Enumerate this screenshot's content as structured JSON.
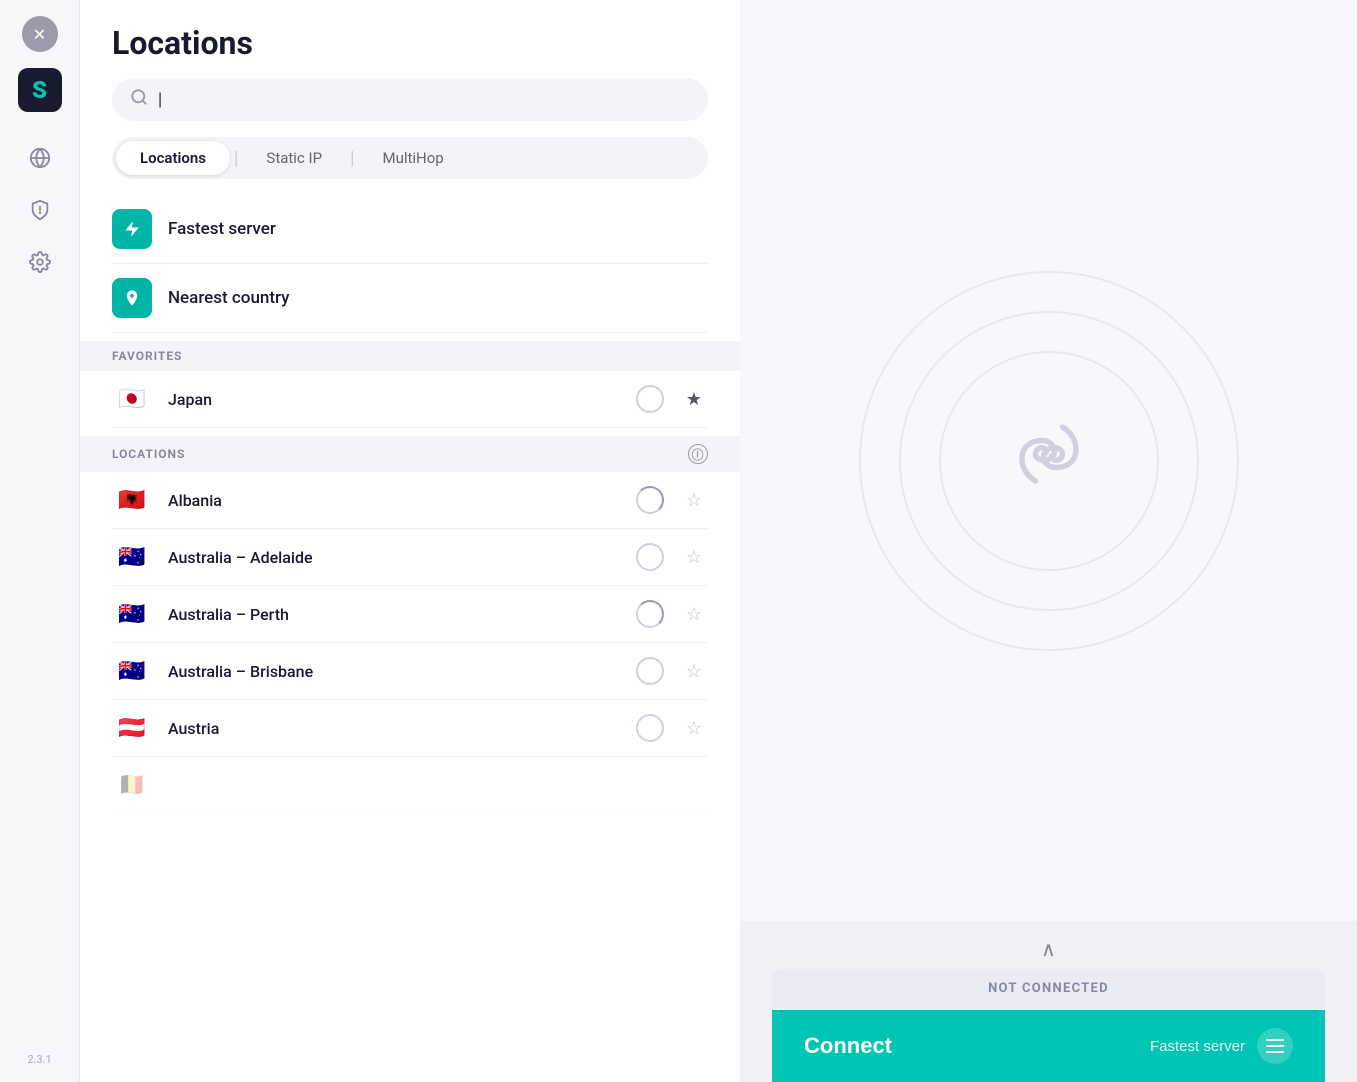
{
  "app": {
    "version": "2.3.1",
    "title": "Locations"
  },
  "sidebar": {
    "close_icon": "×",
    "logo_icon": "S",
    "items": [
      {
        "id": "locations",
        "icon": "🌐",
        "label": "Locations"
      },
      {
        "id": "shield",
        "icon": "🛡",
        "label": "Shield"
      },
      {
        "id": "settings",
        "icon": "⚙",
        "label": "Settings"
      }
    ]
  },
  "tabs": [
    {
      "id": "locations",
      "label": "Locations",
      "active": true
    },
    {
      "id": "static-ip",
      "label": "Static IP",
      "active": false
    },
    {
      "id": "multihop",
      "label": "MultiHop",
      "active": false
    }
  ],
  "search": {
    "placeholder": "",
    "value": ""
  },
  "special_items": [
    {
      "id": "fastest",
      "label": "Fastest server",
      "icon": "⚡"
    },
    {
      "id": "nearest",
      "label": "Nearest country",
      "icon": "📍"
    }
  ],
  "sections": {
    "favorites": {
      "header": "FAVORITES",
      "items": [
        {
          "id": "japan",
          "name": "Japan",
          "flag": "🇯🇵",
          "starred": true,
          "connected": false
        }
      ]
    },
    "locations": {
      "header": "LOCATIONS",
      "items": [
        {
          "id": "albania",
          "name": "Albania",
          "flag": "🇦🇱",
          "starred": false,
          "connected": false,
          "half": true
        },
        {
          "id": "australia-adelaide",
          "name": "Australia – Adelaide",
          "flag": "🇦🇺",
          "starred": false,
          "connected": false,
          "half": false
        },
        {
          "id": "australia-perth",
          "name": "Australia – Perth",
          "flag": "🇦🇺",
          "starred": false,
          "connected": false,
          "half": true
        },
        {
          "id": "australia-brisbane",
          "name": "Australia – Brisbane",
          "flag": "🇦🇺",
          "starred": false,
          "connected": false,
          "half": false
        },
        {
          "id": "austria",
          "name": "Austria",
          "flag": "🇦🇹",
          "starred": false,
          "connected": false,
          "half": false
        }
      ]
    }
  },
  "connection": {
    "status": "NOT CONNECTED",
    "connect_label": "Connect",
    "fastest_label": "Fastest server"
  }
}
